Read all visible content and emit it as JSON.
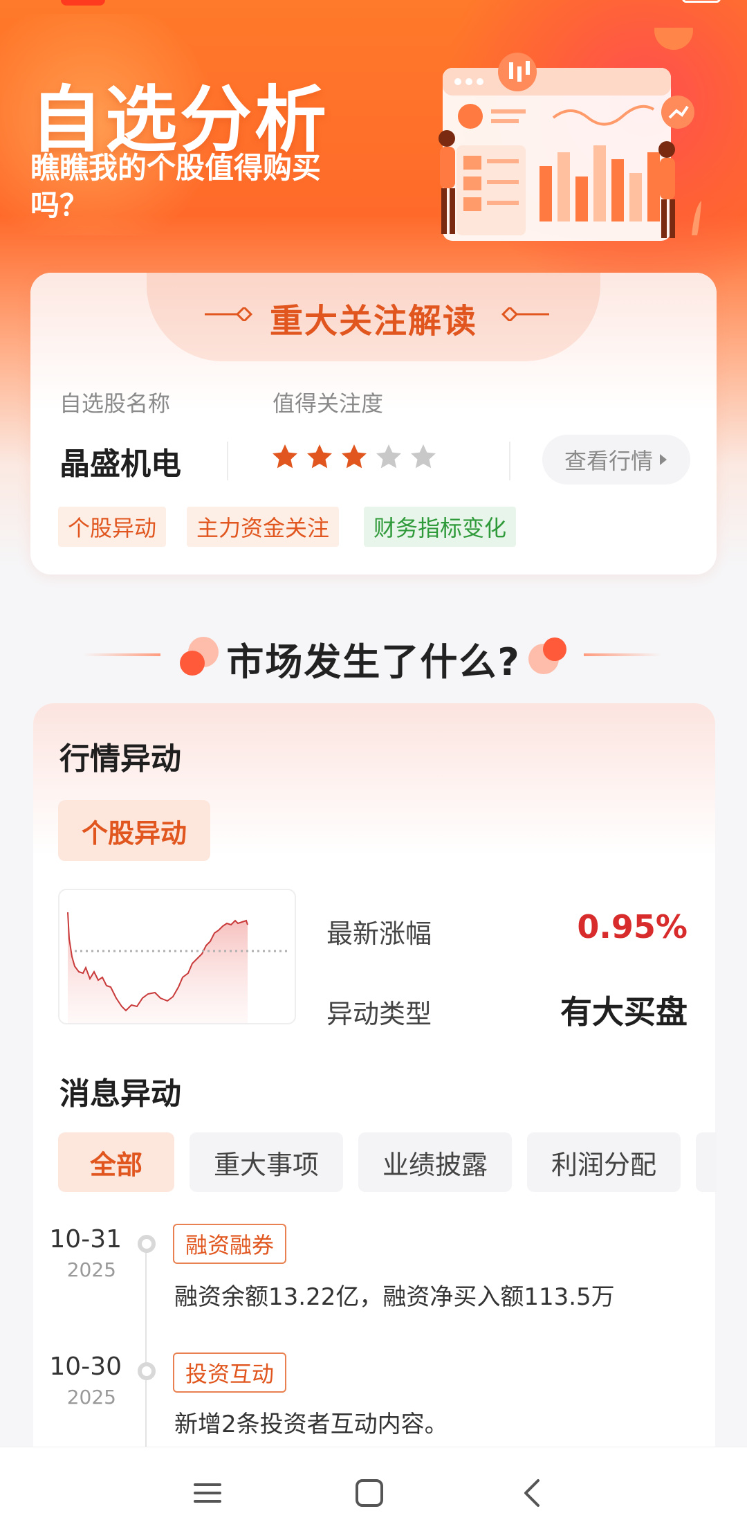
{
  "hero": {
    "title": "自选分析",
    "subtitle": "瞧瞧我的个股值得购买吗？"
  },
  "focus": {
    "title": "重大关注解读",
    "name_label": "自选股名称",
    "attention_label": "值得关注度",
    "stock_name": "晶盛机电",
    "rating": 3,
    "rating_max": 5,
    "quote_button": "查看行情",
    "tags": [
      {
        "label": "个股异动",
        "tone": "orange"
      },
      {
        "label": "主力资金关注",
        "tone": "orange"
      },
      {
        "label": "财务指标变化",
        "tone": "green"
      }
    ]
  },
  "section": {
    "title": "市场发生了什么?"
  },
  "market": {
    "title": "行情异动",
    "pill": "个股异动",
    "latest_change_label": "最新涨幅",
    "latest_change_value": "0.95%",
    "anomaly_type_label": "异动类型",
    "anomaly_type_value": "有大买盘"
  },
  "news": {
    "title": "消息异动",
    "filters": [
      "全部",
      "重大事项",
      "业绩披露",
      "利润分配"
    ],
    "active_filter": "全部",
    "timeline": [
      {
        "date": "10-31",
        "year": "2025",
        "tag": "融资融券",
        "text": "融资余额13.22亿，融资净买入额113.5万"
      },
      {
        "date": "10-30",
        "year": "2025",
        "tag": "投资互动",
        "text": "新增2条投资者互动内容。"
      }
    ]
  },
  "colors": {
    "accent": "#e0561e",
    "up_red": "#d82c2c",
    "green": "#2f9a3a",
    "hero_orange": "#ff6a2a"
  },
  "icons": {
    "nav": [
      "menu-icon",
      "home-icon",
      "back-icon"
    ]
  }
}
